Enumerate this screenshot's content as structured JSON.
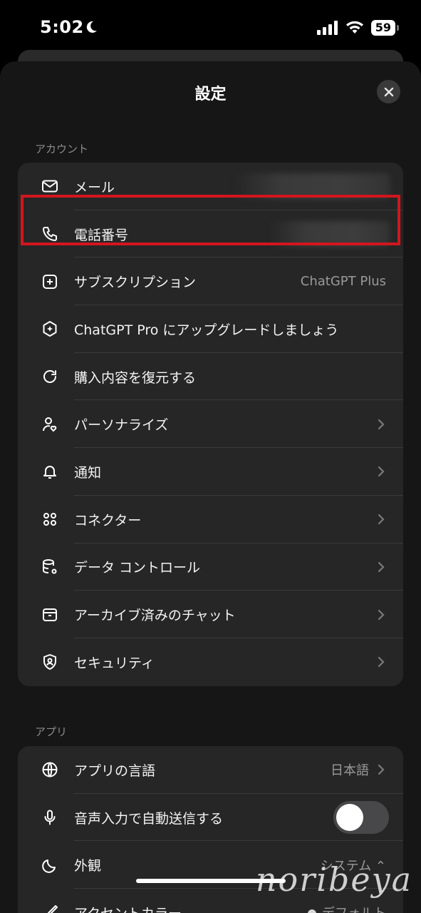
{
  "status_bar": {
    "time": "5:02",
    "battery": "59"
  },
  "header": {
    "title": "設定"
  },
  "account": {
    "section_label": "アカウント",
    "rows": [
      {
        "label": "メール",
        "value": ""
      },
      {
        "label": "電話番号",
        "value": ""
      },
      {
        "label": "サブスクリプション",
        "value": "ChatGPT Plus"
      },
      {
        "label": "ChatGPT Pro にアップグレードしましょう"
      },
      {
        "label": "購入内容を復元する"
      },
      {
        "label": "パーソナライズ"
      },
      {
        "label": "通知"
      },
      {
        "label": "コネクター"
      },
      {
        "label": "データ コントロール"
      },
      {
        "label": "アーカイブ済みのチャット"
      },
      {
        "label": "セキュリティ"
      }
    ]
  },
  "app": {
    "section_label": "アプリ",
    "rows": [
      {
        "label": "アプリの言語",
        "value": "日本語"
      },
      {
        "label": "音声入力で自動送信する"
      },
      {
        "label": "外観",
        "value": "システム ⌃"
      },
      {
        "label": "アクセントカラー",
        "value": "デフォルト"
      }
    ]
  },
  "watermark": "noribeya",
  "colors": {
    "highlight": "#d2161d",
    "background": "#161616",
    "card": "#262626"
  }
}
